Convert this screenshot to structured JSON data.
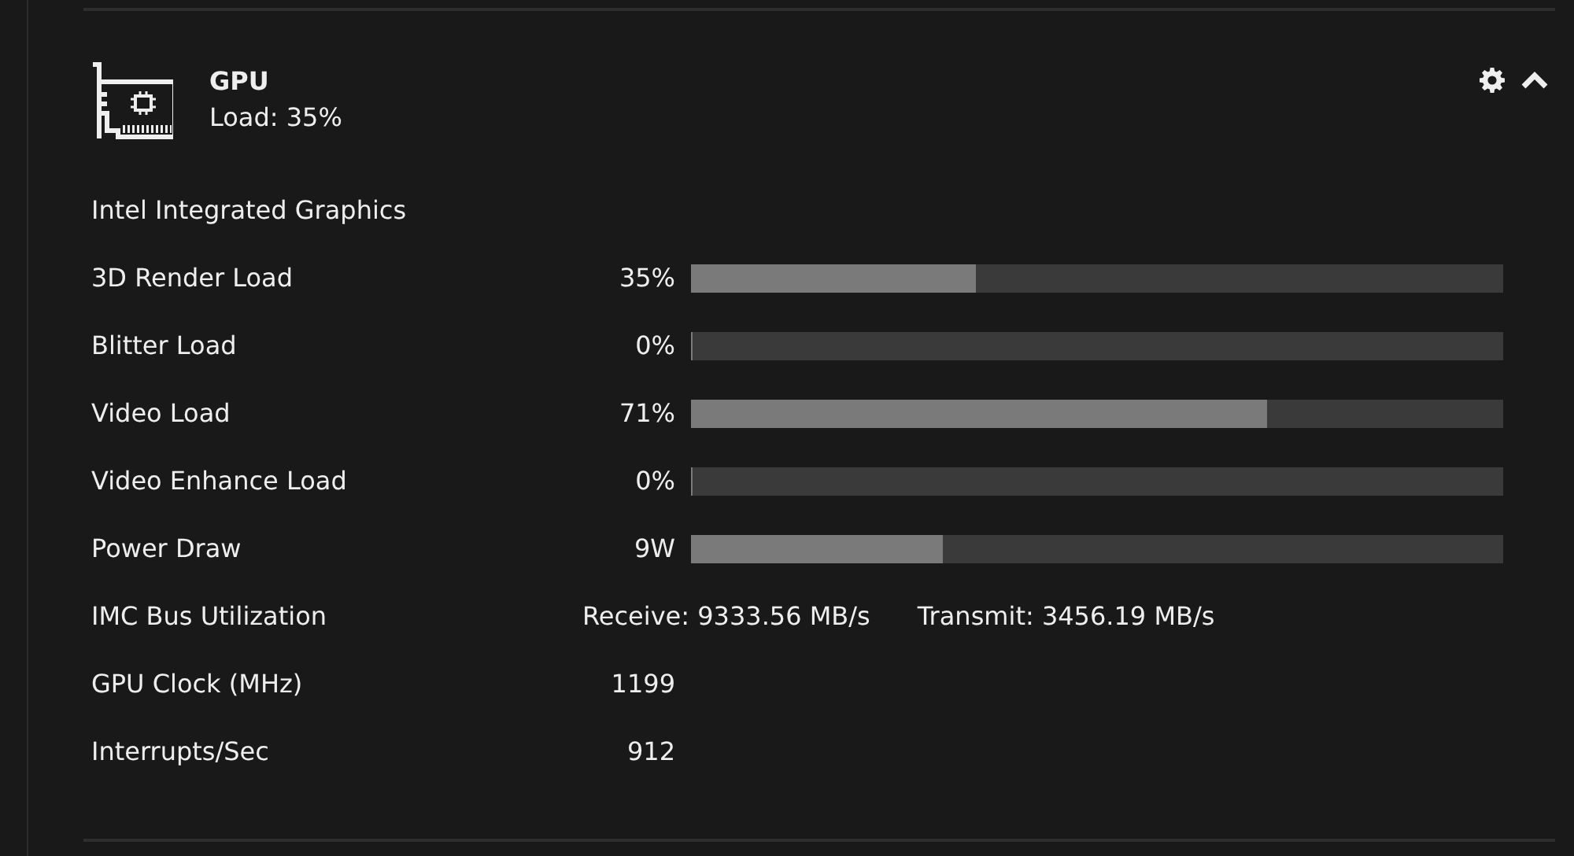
{
  "header": {
    "title": "GPU",
    "subtitle": "Load: 35%",
    "expanded": true
  },
  "device": "Intel Integrated Graphics",
  "rows": [
    {
      "kind": "bar",
      "label": "3D Render Load",
      "value": "35%",
      "level": 0.35
    },
    {
      "kind": "bar",
      "label": "Blitter Load",
      "value": "0%",
      "level": 0
    },
    {
      "kind": "bar",
      "label": "Video Load",
      "value": "71%",
      "level": 0.71
    },
    {
      "kind": "bar",
      "label": "Video Enhance Load",
      "value": "0%",
      "level": 0
    },
    {
      "kind": "bar",
      "label": "Power Draw",
      "value": "9W",
      "level": 0.31
    },
    {
      "kind": "split",
      "label": "IMC Bus Utilization",
      "parts": [
        "Receive: 9333.56 MB/s",
        "Transmit: 3456.19 MB/s"
      ]
    },
    {
      "kind": "value",
      "label": "GPU Clock (MHz)",
      "value": "1199"
    },
    {
      "kind": "value",
      "label": "Interrupts/Sec",
      "value": "912"
    }
  ]
}
